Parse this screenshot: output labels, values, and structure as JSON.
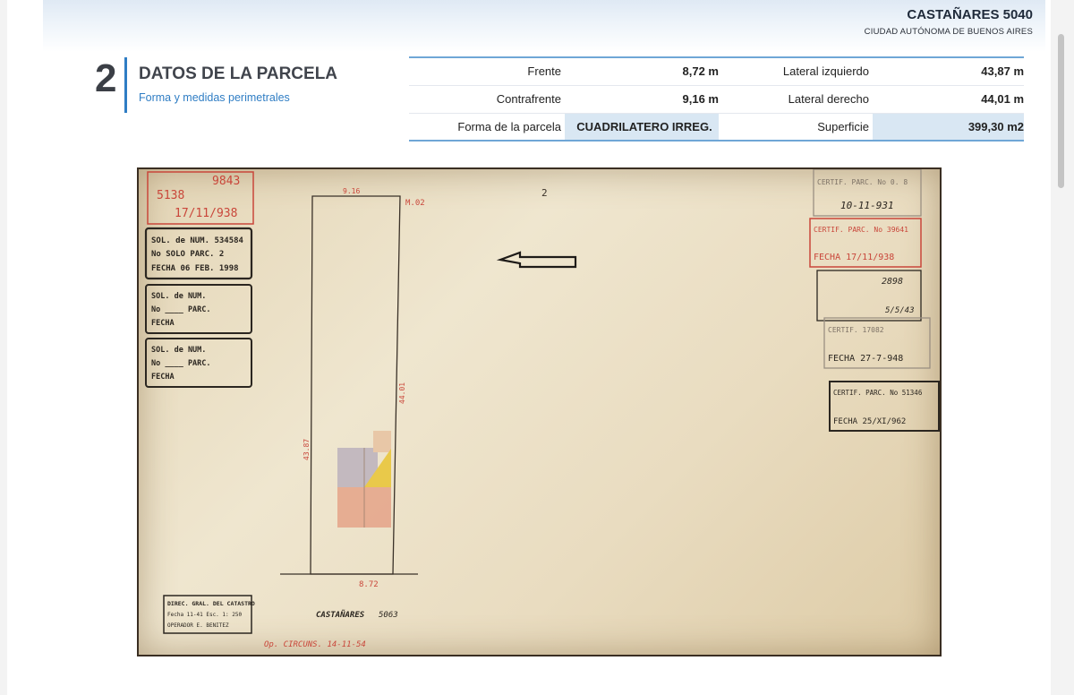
{
  "header": {
    "address": "CASTAÑARES 5040",
    "city": "CIUDAD AUTÓNOMA DE BUENOS AIRES"
  },
  "section": {
    "number": "2",
    "title": "DATOS DE LA PARCELA",
    "subtitle": "Forma y medidas perimetrales"
  },
  "parcel": {
    "frente_label": "Frente",
    "frente_value": "8,72 m",
    "lateral_izq_label": "Lateral izquierdo",
    "lateral_izq_value": "43,87 m",
    "contrafrente_label": "Contrafrente",
    "contrafrente_value": "9,16 m",
    "lateral_der_label": "Lateral derecho",
    "lateral_der_value": "44,01 m",
    "forma_label": "Forma de la parcela",
    "forma_value": "CUADRILATERO IRREG.",
    "superficie_label": "Superficie",
    "superficie_value": "399,30 m2"
  },
  "plan": {
    "stamp_top_left": [
      "9843",
      "5138",
      "17/11/938"
    ],
    "stamp_sol1": [
      "SOL. de NUM. 534584",
      "No SOLO PARC. 2",
      "FECHA 06 FEB. 1998"
    ],
    "stamp_sol2": [
      "SOL. de NUM.",
      "No ____ PARC.",
      "FECHA"
    ],
    "stamp_sol3": [
      "SOL. de NUM.",
      "No ____ PARC.",
      "FECHA"
    ],
    "top_measure": "9.16",
    "top_code": "2",
    "lot_right_label": "M.02",
    "left_measure": "43.87",
    "right_measure": "44.01",
    "bottom_measure": "8.72",
    "street": "CASTAÑARES",
    "street_num": "5063",
    "bottom_note": "Op. CIRCUNS. 14-11-54",
    "right_stamp1": [
      "CERTIF. PARC. No 0. 8",
      "10-11-931"
    ],
    "right_stamp2": [
      "CERTIF. PARC. No 39641",
      "FECHA 17/11/938"
    ],
    "right_stamp3": [
      "2898",
      "5/5/43"
    ],
    "right_stamp4": [
      "CERTIF. 17082",
      "FECHA 27-7-948"
    ],
    "right_stamp5": [
      "CERTIF. PARC. No 51346",
      "FECHA 25/XI/962"
    ],
    "catastro_stamp": [
      "DIREC. GRAL. DEL CATASTRO",
      "Fecha 11-41 Esc. 1: 250",
      "OPERADOR E. BENITEZ"
    ]
  },
  "colors": {
    "accent": "#2f7dc4",
    "highlight": "#d9e7f3",
    "stamp_red": "#c9463a",
    "stamp_dark": "#2b2620"
  }
}
